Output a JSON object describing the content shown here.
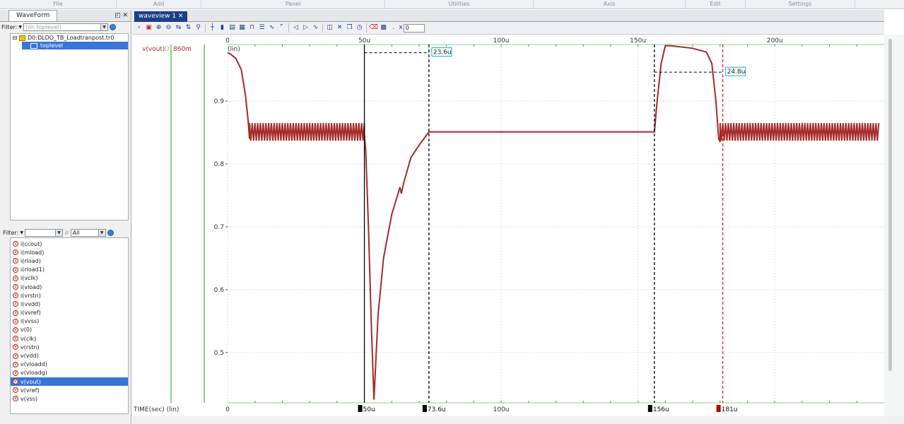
{
  "menu": [
    "File",
    "Add",
    "Panel",
    "Utilities",
    "Axis",
    "Edit",
    "Settings"
  ],
  "left_panel": {
    "tab_label": "WaveForm",
    "tab_controls": "◰ ✕",
    "filter_label": "Filter:",
    "filter_placeholder": "(on toplevel)",
    "tree": [
      {
        "label": "D0:DLDO_TB_Loadtranpost.tr0",
        "selected": false
      },
      {
        "label": "toplevel",
        "selected": true
      }
    ],
    "filter2_label": "Filter:",
    "filter2_value": "All",
    "signals": [
      {
        "name": "i(ccout)",
        "type": "i"
      },
      {
        "name": "i(mload)",
        "type": "i"
      },
      {
        "name": "i(rload)",
        "type": "i"
      },
      {
        "name": "i(rload1)",
        "type": "i"
      },
      {
        "name": "i(vclk)",
        "type": "i"
      },
      {
        "name": "i(vload)",
        "type": "i"
      },
      {
        "name": "i(vrstn)",
        "type": "i"
      },
      {
        "name": "i(vvdd)",
        "type": "i"
      },
      {
        "name": "i(vvref)",
        "type": "i"
      },
      {
        "name": "i(vvss)",
        "type": "i"
      },
      {
        "name": "v(0)",
        "type": "v"
      },
      {
        "name": "v(clk)",
        "type": "v"
      },
      {
        "name": "v(rstn)",
        "type": "v"
      },
      {
        "name": "v(vdd)",
        "type": "v"
      },
      {
        "name": "v(vloadd)",
        "type": "v"
      },
      {
        "name": "v(vloadg)",
        "type": "v"
      },
      {
        "name": "v(vout)",
        "type": "v",
        "selected": true
      },
      {
        "name": "v(vref)",
        "type": "v"
      },
      {
        "name": "v(vss)",
        "type": "v"
      }
    ]
  },
  "waveview": {
    "tab_label": "waveview 1 ✕",
    "x_input": "0",
    "signal_label": "v(vout)",
    "signal_prefix": "D",
    "signal_value": "860m",
    "scale_label": "(lin)",
    "x_axis_label": "TIME(sec) (lin)",
    "colors": {
      "trace": "#a52a2a",
      "cursor_red": "#e02020",
      "marker_box": "#00bcd4"
    }
  },
  "chart_data": {
    "type": "line",
    "xlabel": "TIME(sec) (lin)",
    "ylabel": "(lin)",
    "xlim": [
      0,
      240
    ],
    "ylim": [
      0.42,
      0.99
    ],
    "x_ticks": [
      {
        "v": 0,
        "label": "0"
      },
      {
        "v": 50,
        "label": "50u"
      },
      {
        "v": 100,
        "label": "100u"
      },
      {
        "v": 150,
        "label": "150u"
      },
      {
        "v": 200,
        "label": "200u"
      }
    ],
    "y_ticks": [
      {
        "v": 0.5,
        "label": "0.5"
      },
      {
        "v": 0.6,
        "label": "0.6"
      },
      {
        "v": 0.7,
        "label": "0.7"
      },
      {
        "v": 0.8,
        "label": "0.8"
      },
      {
        "v": 0.9,
        "label": "0.9"
      }
    ],
    "series": [
      {
        "x": [
          0,
          1,
          3,
          5,
          6.5,
          7.5,
          8
        ],
        "y": [
          0.977,
          0.975,
          0.968,
          0.95,
          0.91,
          0.87,
          0.84
        ],
        "ripple": [
          {
            "x0": 8,
            "x1": 50,
            "center": 0.851,
            "amp": 0.014
          },
          {
            "x0": 180,
            "x1": 238,
            "center": 0.851,
            "amp": 0.014
          }
        ],
        "segments": [
          {
            "x": [
              50,
              50.5,
              51.5,
              52.5,
              53.5,
              55,
              57,
              60,
              63,
              63.5,
              64.5,
              67,
              70,
              73.6,
              156
            ],
            "y": [
              0.846,
              0.82,
              0.7,
              0.55,
              0.425,
              0.56,
              0.65,
              0.72,
              0.763,
              0.753,
              0.772,
              0.81,
              0.83,
              0.851,
              0.851
            ]
          },
          {
            "x": [
              156,
              157,
              158.5,
              160,
              162,
              170,
              175,
              177,
              178.5,
              179.5,
              180
            ],
            "y": [
              0.851,
              0.9,
              0.96,
              0.988,
              0.988,
              0.984,
              0.978,
              0.96,
              0.9,
              0.84,
              0.835
            ]
          }
        ]
      }
    ],
    "cursors": [
      {
        "x": 50,
        "label": "50u",
        "style": "solid"
      },
      {
        "x": 73.6,
        "label": "73.6u",
        "style": "dashed"
      },
      {
        "x": 156,
        "label": "156u",
        "style": "dashed"
      },
      {
        "x": 181,
        "label": "181u",
        "style": "dashed-red"
      }
    ],
    "measurements": [
      {
        "label": "23.6u",
        "from": 50,
        "to": 73.6,
        "y": 0.977
      },
      {
        "label": "24.8u",
        "from": 156,
        "to": 181,
        "y": 0.946
      }
    ]
  }
}
